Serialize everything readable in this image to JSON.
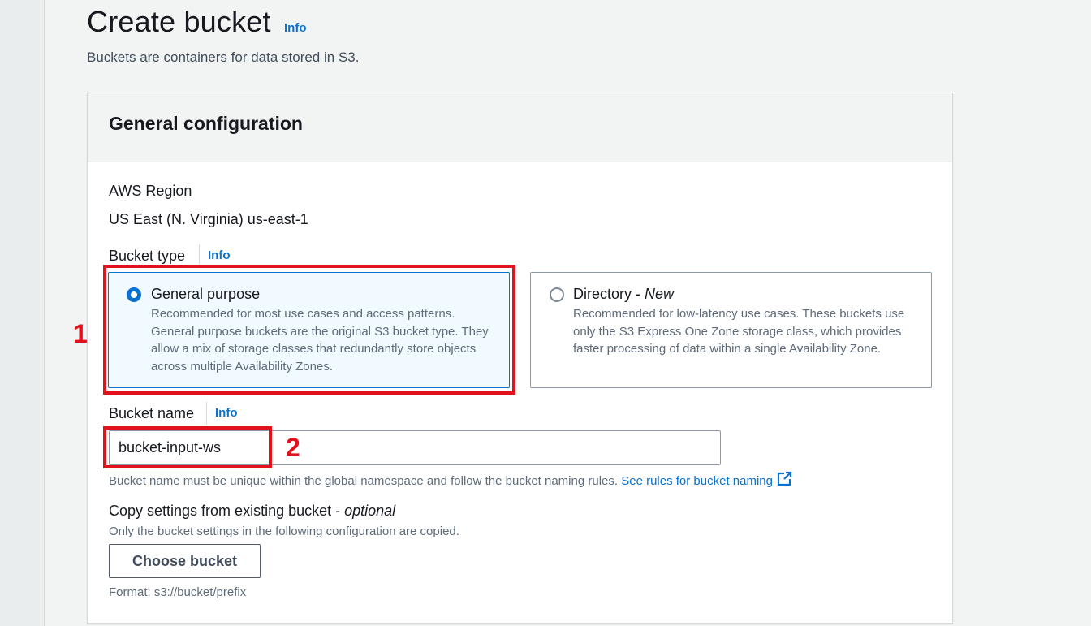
{
  "header": {
    "title": "Create bucket",
    "info_label": "Info",
    "description": "Buckets are containers for data stored in S3."
  },
  "general_config": {
    "title": "General configuration",
    "region_label": "AWS Region",
    "region_value": "US East (N. Virginia) us-east-1",
    "bucket_type_label": "Bucket type",
    "bucket_type_info": "Info",
    "options": [
      {
        "title": "General purpose",
        "title_suffix": "",
        "description": "Recommended for most use cases and access patterns. General purpose buckets are the original S3 bucket type. They allow a mix of storage classes that redundantly store objects across multiple Availability Zones.",
        "selected": true
      },
      {
        "title": "Directory - ",
        "title_suffix": "New",
        "description": "Recommended for low-latency use cases. These buckets use only the S3 Express One Zone storage class, which provides faster processing of data within a single Availability Zone.",
        "selected": false
      }
    ],
    "bucket_name_label": "Bucket name",
    "bucket_name_info": "Info",
    "bucket_name_value": "bucket-input-ws",
    "bucket_name_hint": "Bucket name must be unique within the global namespace and follow the bucket naming rules.",
    "bucket_name_rules_link": "See rules for bucket naming",
    "copy_label": "Copy settings from existing bucket - ",
    "copy_label_optional": "optional",
    "copy_description": "Only the bucket settings in the following configuration are copied.",
    "choose_bucket_button": "Choose bucket",
    "format_hint": "Format: s3://bucket/prefix"
  },
  "annotations": [
    {
      "label": "1"
    },
    {
      "label": "2"
    }
  ],
  "colors": {
    "link": "#0972d3",
    "annotation": "#e2121d",
    "selected_tile_bg": "#f1faff",
    "page_bg": "#f2f3f3"
  }
}
